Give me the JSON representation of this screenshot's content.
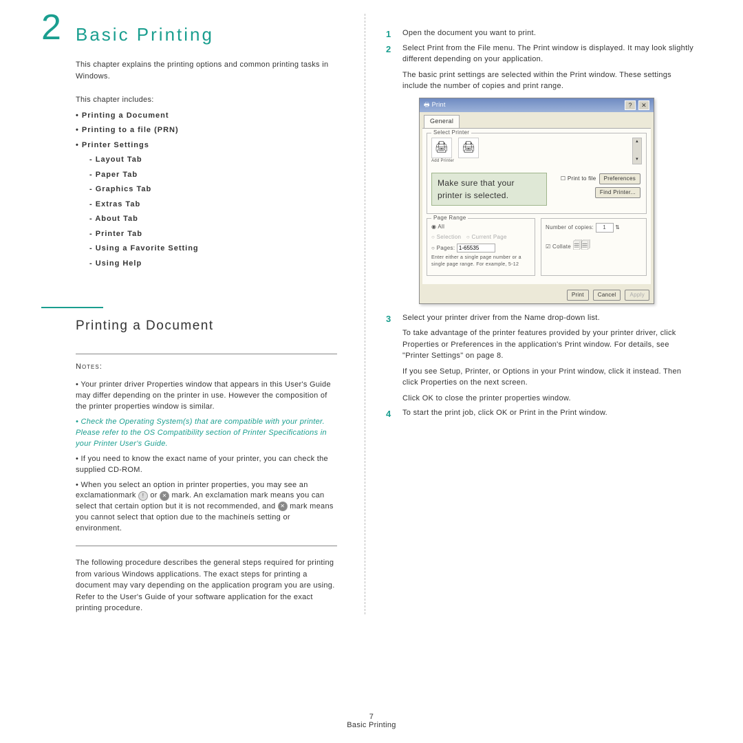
{
  "chapter": {
    "num": "2",
    "title": "Basic Printing"
  },
  "intro": "This chapter explains the printing options and common printing tasks in Windows.",
  "toc": {
    "lead": "This chapter includes:",
    "items": [
      "Printing a Document",
      "Printing to a file (PRN)",
      "Printer Settings"
    ],
    "subs": [
      "Layout Tab",
      "Paper Tab",
      "Graphics Tab",
      "Extras Tab",
      "About Tab",
      "Printer Tab",
      "Using a Favorite Setting",
      "Using Help"
    ]
  },
  "section1_title": "Printing a Document",
  "notes_label": "Notes:",
  "notes": [
    "Your printer driver Properties window that appears in this User's Guide may differ depending on the printer in use. However the composition of the printer properties window is similar.",
    "Check the Operating System(s) that are compatible with your printer. Please refer to the OS Compatibility section of Printer Specifications in your Printer User's Guide.",
    "If you need to know the exact name of your printer, you can check the supplied CD-ROM.",
    "When you select an option in printer properties, you may see an exclamationmark ",
    " or ",
    " mark. An exclamation mark means you can select that certain option but it is not recommended, and ",
    " mark means you cannot select that option due to the machineís setting or environment."
  ],
  "following": "The following procedure describes the general steps required for printing from various Windows applications. The exact steps for printing a document may vary depending on the application program you are using. Refer to the User's Guide of your software application for the exact printing procedure.",
  "steps": {
    "s1": "Open the document you want to print.",
    "s2a": "Select Print from the File menu. The Print window is displayed. It may look slightly different depending on your application.",
    "s2b": "The basic print settings are selected within the Print window. These settings include the number of copies and print range.",
    "s3a": "Select your printer driver from the Name drop-down list.",
    "s3b": "To take advantage of the printer features provided by your printer driver, click Properties or Preferences in the application's Print window. For details, see \"Printer Settings\" on page 8.",
    "s3c": "If you see Setup, Printer, or Options in your Print window, click it instead. Then click Properties on the next screen.",
    "s3d": "Click OK to close the printer properties window.",
    "s4": "To start the print job, click OK or Print in the Print window."
  },
  "dialog": {
    "title": "Print",
    "tab": "General",
    "grouplabel": "Select Printer",
    "addprinter": "Add Printer",
    "callout": "Make sure that your printer is selected.",
    "print_to_file": "Print to file",
    "preferences": "Preferences",
    "find_printer": "Find Printer...",
    "page_range_label": "Page Range",
    "all": "All",
    "selection": "Selection",
    "current": "Current Page",
    "pages": "Pages:",
    "pages_val": "1-65535",
    "hint": "Enter either a single page number or a single page range. For example, 5-12",
    "copies_label": "Number of copies:",
    "copies_val": "1",
    "collate": "Collate",
    "print": "Print",
    "cancel": "Cancel",
    "apply": "Apply"
  },
  "footer": {
    "page": "7",
    "title": "Basic Printing"
  }
}
